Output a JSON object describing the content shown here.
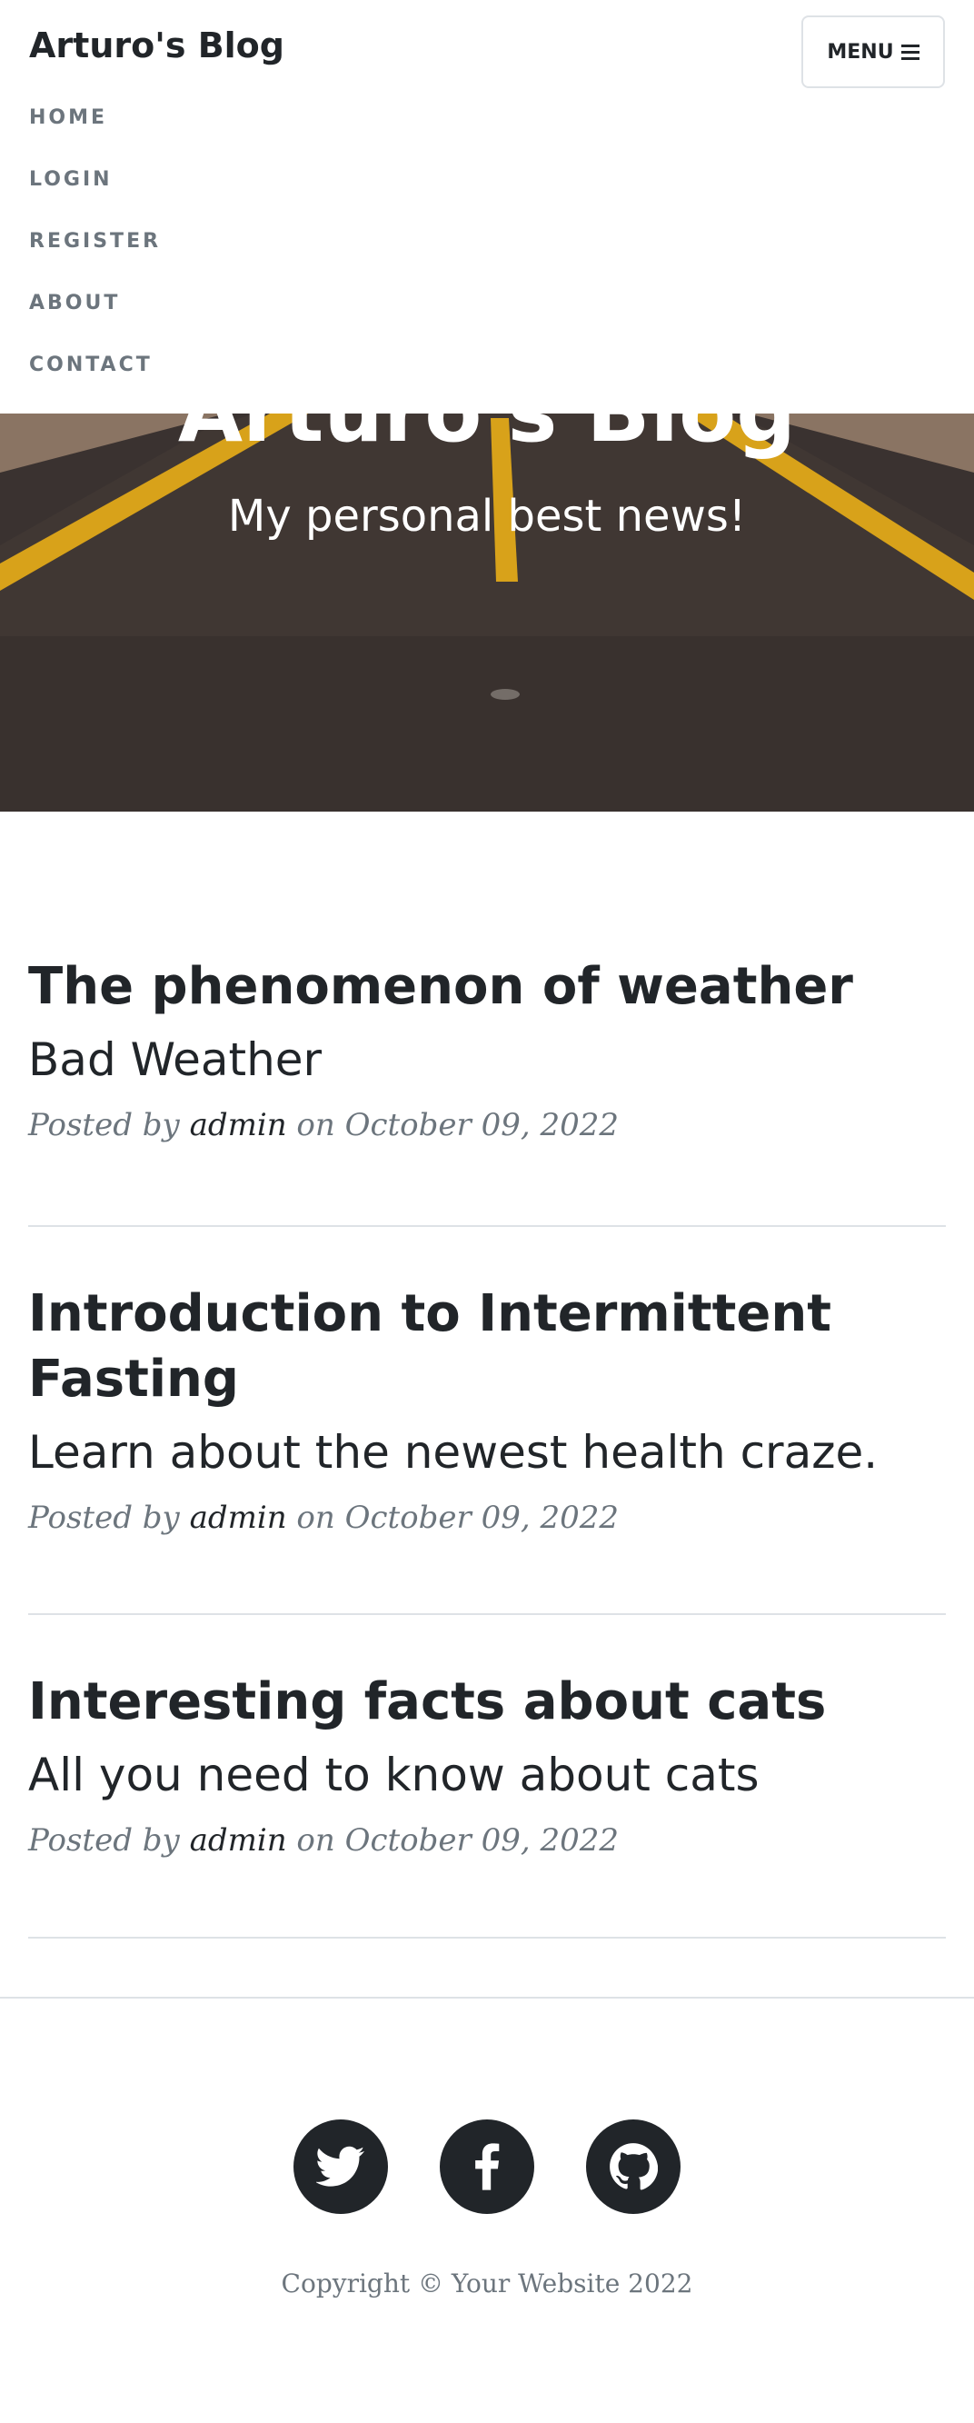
{
  "navbar": {
    "brand": "Arturo's Blog",
    "menu_label": "MENU",
    "items": [
      "HOME",
      "LOGIN",
      "REGISTER",
      "ABOUT",
      "CONTACT"
    ]
  },
  "hero": {
    "title": "Arturo's Blog",
    "subtitle": "My personal best news!"
  },
  "posts": [
    {
      "title": "The phenomenon of weather",
      "subtitle": "Bad Weather",
      "posted_by": "Posted by",
      "author": "admin",
      "date": "on October 09, 2022"
    },
    {
      "title": "Introduction to Intermittent Fasting",
      "subtitle": "Learn about the newest health craze.",
      "posted_by": "Posted by",
      "author": "admin",
      "date": "on October 09, 2022"
    },
    {
      "title": "Interesting facts about cats",
      "subtitle": "All you need to know about cats",
      "posted_by": "Posted by",
      "author": "admin",
      "date": "on October 09, 2022"
    }
  ],
  "footer": {
    "social": [
      "twitter-icon",
      "facebook-icon",
      "github-icon"
    ],
    "copyright": "Copyright © Your Website 2022"
  },
  "colors": {
    "text_dark": "#212529",
    "text_muted": "#6c757d",
    "divider": "#dee2e6",
    "road_line": "#e0a81a"
  }
}
